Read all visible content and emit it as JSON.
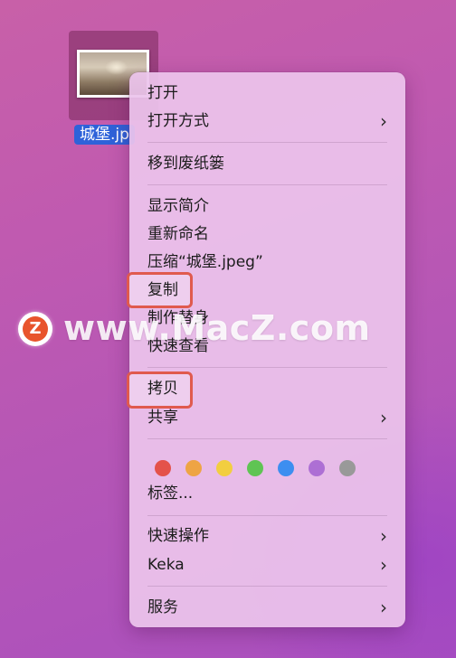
{
  "file": {
    "label": "城堡.jp"
  },
  "menu": {
    "open": "打开",
    "open_with": "打开方式",
    "move_to_trash": "移到废纸篓",
    "get_info": "显示简介",
    "rename": "重新命名",
    "compress": "压缩“城堡.jpeg”",
    "duplicate": "复制",
    "make_alias": "制作替身",
    "quick_look": "快速查看",
    "copy": "拷贝",
    "share": "共享",
    "tags_label": "标签...",
    "quick_actions": "快速操作",
    "keka": "Keka",
    "services": "服务",
    "chevron": "›"
  },
  "tag_colors": [
    {
      "name": "red",
      "hex": "#e4524a"
    },
    {
      "name": "orange",
      "hex": "#eea444"
    },
    {
      "name": "yellow",
      "hex": "#f2ce40"
    },
    {
      "name": "green",
      "hex": "#5fc453"
    },
    {
      "name": "blue",
      "hex": "#3d8ef0"
    },
    {
      "name": "purple",
      "hex": "#ad6fd4"
    },
    {
      "name": "gray",
      "hex": "#999999"
    }
  ],
  "highlight_color": "#e05a4e",
  "watermark": {
    "logo_letter": "Z",
    "text": "www.MacZ.com"
  }
}
